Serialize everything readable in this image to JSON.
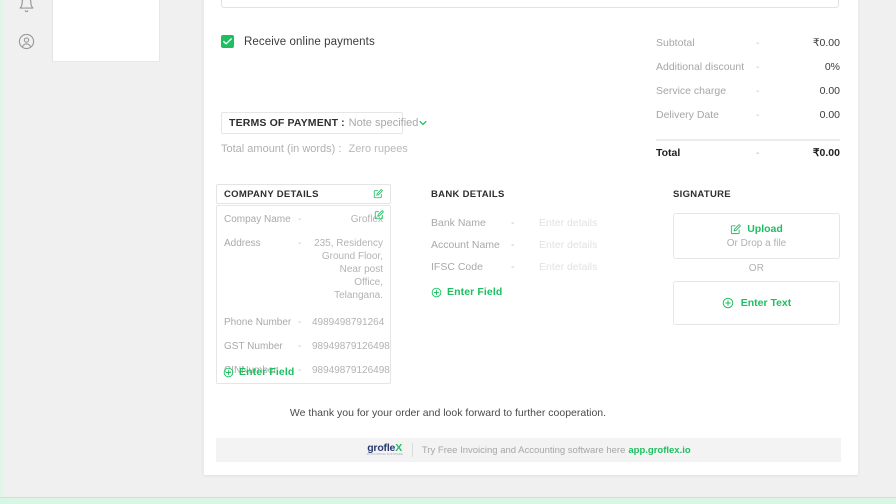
{
  "sidebar": {
    "icons": [
      {
        "name": "notification-bell-icon"
      },
      {
        "name": "user-account-icon"
      }
    ]
  },
  "note_field": {
    "value": "",
    "placeholder": ""
  },
  "online_payments": {
    "label": "Receive online payments",
    "checked": true
  },
  "terms_of_payment": {
    "label": "TERMS OF PAYMENT",
    "colon": ":",
    "value": "Note specified"
  },
  "total_in_words": {
    "label": "Total amount (in words) :",
    "value": "Zero rupees"
  },
  "summary": {
    "rows": [
      {
        "label": "Subtotal",
        "dash": "-",
        "value": "₹0.00"
      },
      {
        "label": "Additional discount",
        "dash": "-",
        "value": "0%"
      },
      {
        "label": "Service charge",
        "dash": "-",
        "value": "0.00"
      },
      {
        "label": "Delivery Date",
        "dash": "-",
        "value": "0.00"
      }
    ],
    "total": {
      "label": "Total",
      "dash": "-",
      "value": "₹0.00"
    }
  },
  "company_details": {
    "title": "COMPANY DETAILS",
    "rows": [
      {
        "key": "Compay Name",
        "dash": "-",
        "value": "Groflex"
      },
      {
        "key": "Address",
        "dash": "-",
        "value": "235, Residency Ground Floor, Near post Office, Telangana."
      },
      {
        "key": "Phone Number",
        "dash": "-",
        "value": "4989498791264"
      },
      {
        "key": "GST Number",
        "dash": "-",
        "value": "98949879126498"
      },
      {
        "key": "CINNumber",
        "dash": "-",
        "value": "98949879126498"
      }
    ],
    "enter_field_label": "Enter Field"
  },
  "bank_details": {
    "title": "BANK DETAILS",
    "rows": [
      {
        "key": "Bank Name",
        "dash": "-",
        "value": "Enter details"
      },
      {
        "key": "Account Name",
        "dash": "-",
        "value": "Enter details"
      },
      {
        "key": "IFSC Code",
        "dash": "-",
        "value": "Enter details"
      }
    ],
    "enter_field_label": "Enter Field"
  },
  "signature": {
    "title": "SIGNATURE",
    "upload_label": "Upload",
    "upload_sub": "Or Drop a file",
    "or_label": "OR",
    "enter_text_label": "Enter Text"
  },
  "thank_you": "We thank you for your order and look forward to further cooperation.",
  "footer": {
    "logo_main": "grofle",
    "logo_x": "X",
    "logo_sub": "ACCOUNTING SOFTWARE",
    "text": "Try Free Invoicing and Accounting software here",
    "link": "app.groflex.io"
  },
  "colors": {
    "accent_green": "#1dbf61",
    "brand_navy": "#2b3a72",
    "page_bg": "#f0f0f0",
    "panel_bg": "#ffffff"
  }
}
